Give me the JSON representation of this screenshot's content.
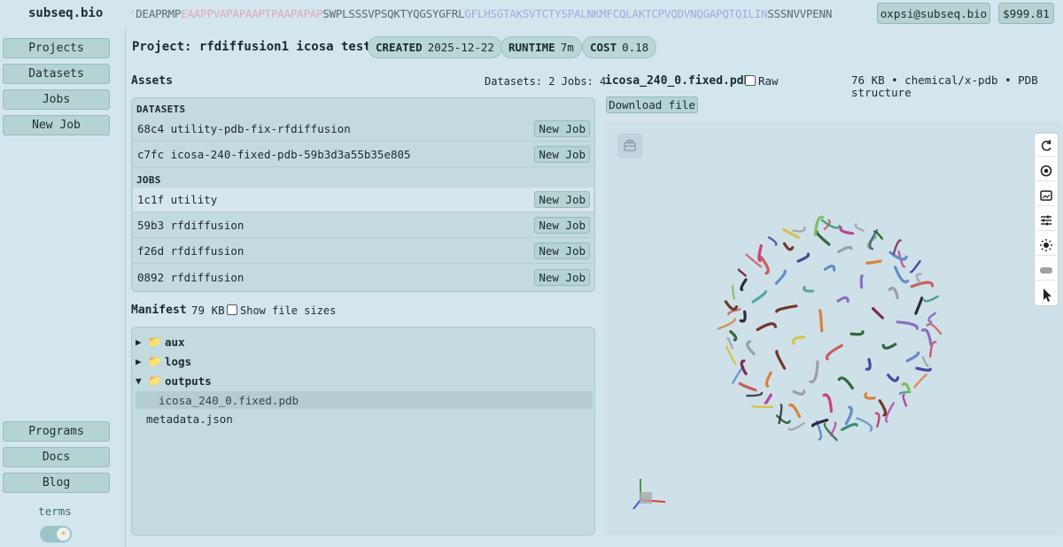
{
  "header": {
    "brand": "subseq.bio",
    "sequence": [
      {
        "t": "'",
        "c": "s1"
      },
      {
        "t": "DEAPRMP",
        "c": "s0"
      },
      {
        "t": "EAAPPVAPAPAAPTPAAPAPAP",
        "c": "s1"
      },
      {
        "t": "SWPLSSSVPSQKTYQGSYGFRL",
        "c": "s0"
      },
      {
        "t": "GFLHSGTAKSVTCTYSPALNKMFCQLAKTCPVQDVNQGAPQTQILIN",
        "c": "s2"
      },
      {
        "t": "SSSNVVPENN",
        "c": "s0"
      }
    ],
    "user": "oxpsi@subseq.bio",
    "credit": "$999.81"
  },
  "sidebar": {
    "top": [
      "Projects",
      "Datasets",
      "Jobs",
      "New Job"
    ],
    "bottom": [
      "Programs",
      "Docs",
      "Blog"
    ],
    "terms": "terms"
  },
  "project": {
    "title": "Project: rfdiffusion1 icosa tests",
    "created_label": "CREATED",
    "created": "2025-12-22",
    "runtime_label": "RUNTIME",
    "runtime": "7m",
    "cost_label": "COST",
    "cost": "0.18"
  },
  "assets": {
    "heading": "Assets",
    "counts": "Datasets: 2 Jobs: 4",
    "datasets_heading": "DATASETS",
    "jobs_heading": "JOBS",
    "new_job_label": "New Job",
    "datasets": [
      "68c4 utility-pdb-fix-rfdiffusion",
      "c7fc icosa-240-fixed-pdb-59b3d3a55b35e805"
    ],
    "jobs": [
      "1c1f utility",
      "59b3 rfdiffusion",
      "f26d rfdiffusion",
      "0892 rfdiffusion"
    ]
  },
  "manifest": {
    "heading": "Manifest",
    "size": "79 KB",
    "show_sizes_label": "Show file sizes",
    "folders": [
      {
        "name": "aux",
        "expanded": false
      },
      {
        "name": "logs",
        "expanded": false
      },
      {
        "name": "outputs",
        "expanded": true
      }
    ],
    "selected_file": "icosa_240_0.fixed.pdb",
    "root_file": "metadata.json"
  },
  "file_view": {
    "name": "icosa_240_0.fixed.pdb",
    "raw_label": "Raw",
    "meta": "76 KB • chemical/x-pdb • PDB structure",
    "download_label": "Download file"
  },
  "viewer": {
    "toolbar_icons": [
      "reset-rotation-icon",
      "focus-icon",
      "screenshot-icon",
      "settings-sliders-icon",
      "lighting-icon",
      "vr-icon",
      "select-cursor-icon"
    ]
  }
}
